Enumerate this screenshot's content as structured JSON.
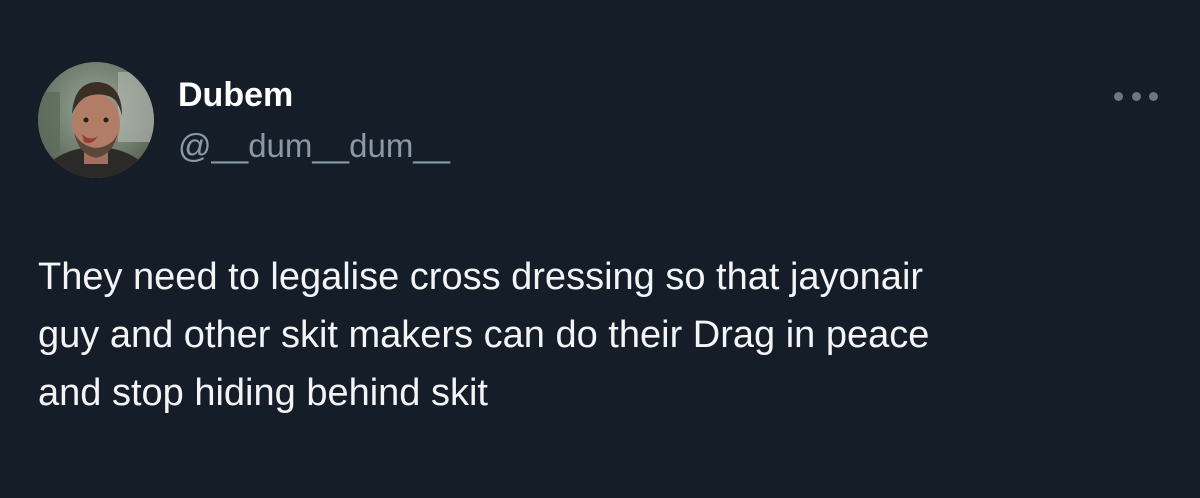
{
  "tweet": {
    "author": {
      "display_name": "Dubem",
      "handle": "@__dum__dum__",
      "avatar_icon": "profile-photo"
    },
    "more_icon": "more-dots-icon",
    "text": "They need to legalise cross dressing so that jayonair\nguy and other skit makers can do their Drag in peace\nand stop hiding behind skit"
  },
  "colors": {
    "background": "#151d29",
    "name": "#ffffff",
    "handle": "#8b98a5",
    "text": "#f2f4f5",
    "more_dots": "#71767b"
  }
}
